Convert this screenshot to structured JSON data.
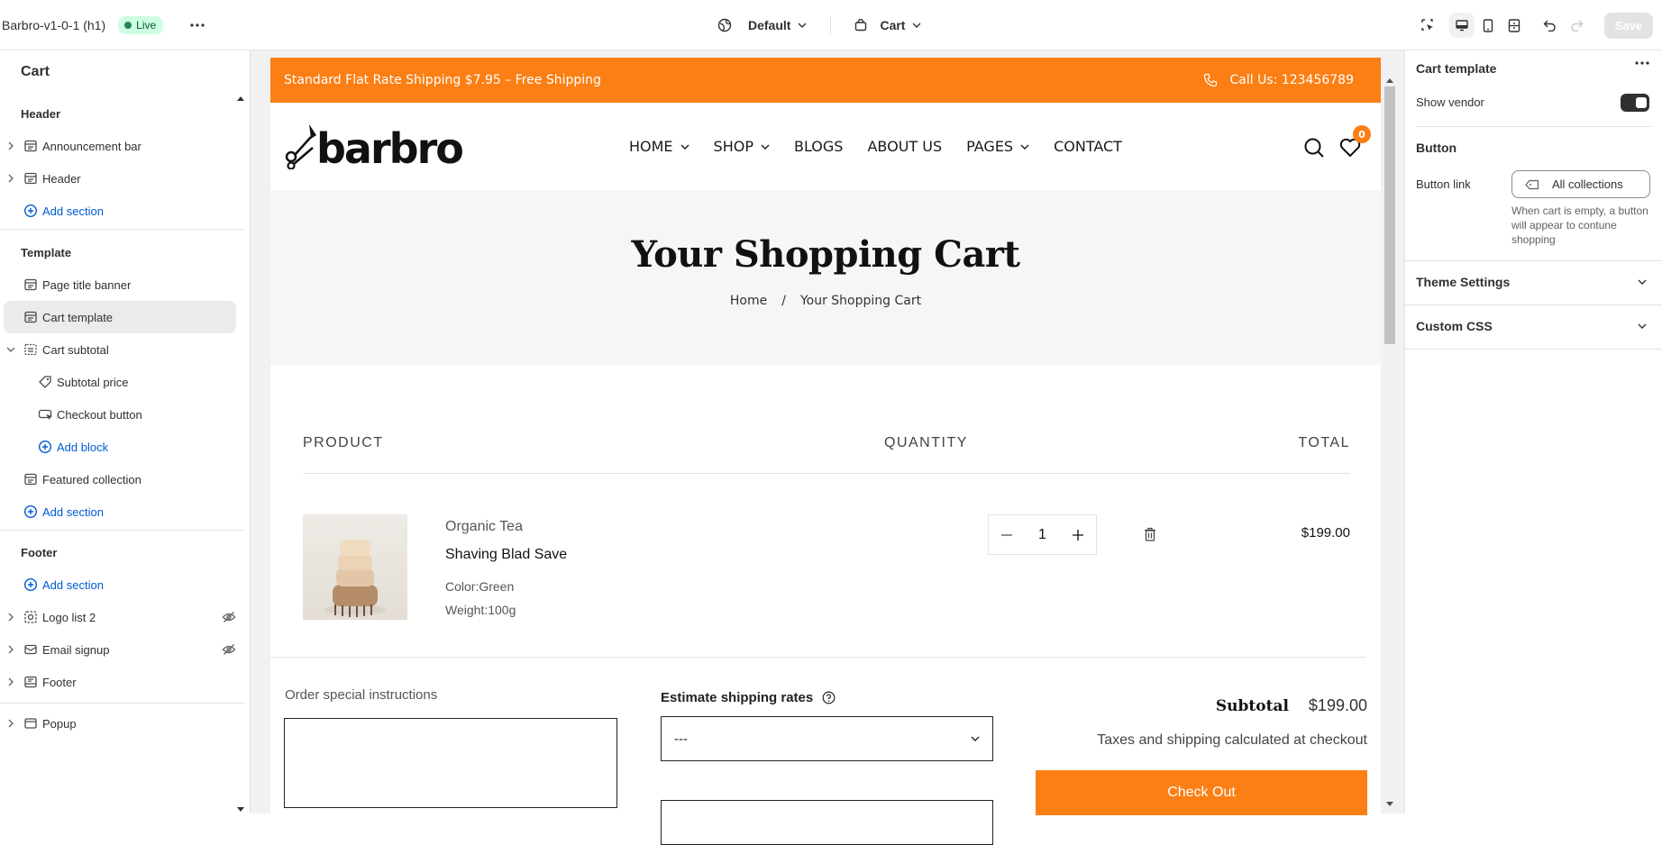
{
  "topbar": {
    "store_name": "Barbro-v1-0-1 (h1)",
    "status": "Live",
    "theme_select": "Default",
    "page_select": "Cart",
    "save_label": "Save"
  },
  "sidebar": {
    "title": "Cart",
    "header_group": {
      "label": "Header",
      "items": [
        "Announcement bar",
        "Header"
      ],
      "add": "Add section"
    },
    "template_group": {
      "label": "Template",
      "page_title_banner": "Page title banner",
      "cart_template": "Cart template",
      "cart_subtotal": "Cart subtotal",
      "subtotal_price": "Subtotal price",
      "checkout_button": "Checkout button",
      "add_block": "Add block",
      "featured_collection": "Featured collection",
      "add": "Add section"
    },
    "footer_group": {
      "label": "Footer",
      "add": "Add section",
      "items": [
        "Logo list 2",
        "Email signup",
        "Footer"
      ]
    },
    "popup": "Popup"
  },
  "preview": {
    "announcement": "Standard Flat Rate Shipping $7.95 – Free Shipping",
    "call": "Call Us: 123456789",
    "logo": "barbro",
    "nav": [
      "HOME",
      "SHOP",
      "BLOGS",
      "ABOUT US",
      "PAGES",
      "CONTACT"
    ],
    "wishlist_count": "0",
    "page_title": "Your Shopping Cart",
    "breadcrumb": {
      "home": "Home",
      "sep": "/",
      "current": "Your Shopping Cart"
    },
    "table_headers": {
      "product": "PRODUCT",
      "quantity": "QUANTITY",
      "total": "TOTAL"
    },
    "item": {
      "vendor": "Organic Tea",
      "name": "Shaving Blad Save",
      "color": "Color:Green",
      "weight": "Weight:100g",
      "quantity": "1",
      "total": "$199.00"
    },
    "notes_label": "Order special instructions",
    "shipping_label": "Estimate shipping rates",
    "shipping_select": "---",
    "subtotal_label": "Subtotal",
    "subtotal_value": "$199.00",
    "tax_note": "Taxes and shipping calculated at checkout",
    "checkout": "Check Out",
    "accent_color": "#fb7f14"
  },
  "rpanel": {
    "title": "Cart template",
    "show_vendor": "Show vendor",
    "show_vendor_on": true,
    "button_section": "Button",
    "button_link_label": "Button link",
    "button_link_value": "All collections",
    "button_help": "When cart is empty, a button will appear to contune shopping",
    "theme_settings": "Theme Settings",
    "custom_css": "Custom CSS"
  }
}
